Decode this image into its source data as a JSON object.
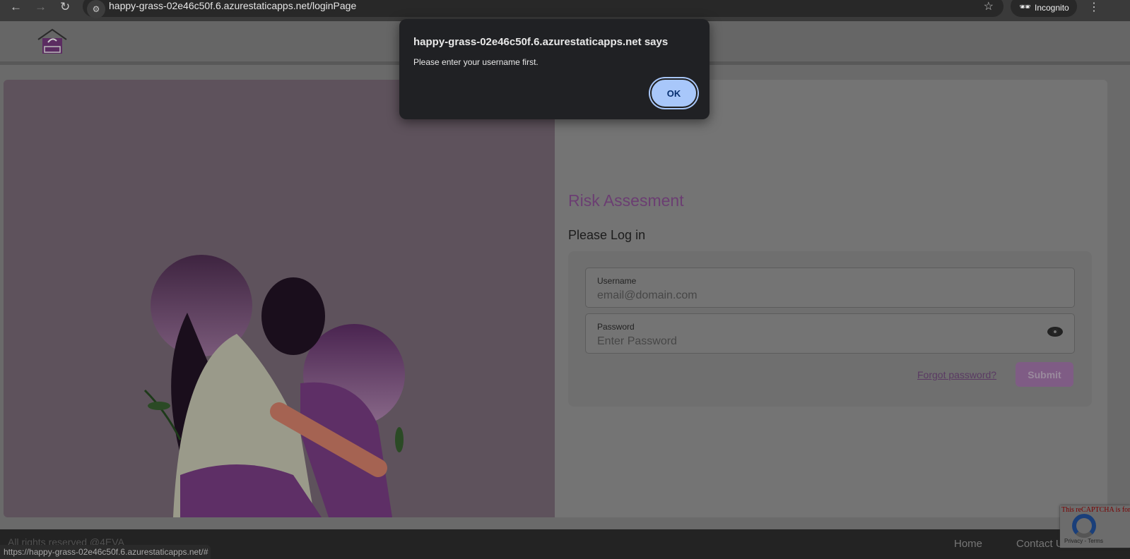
{
  "browser": {
    "url": "happy-grass-02e46c50f.6.azurestaticapps.net/loginPage",
    "profile": "Incognito",
    "status_url": "https://happy-grass-02e46c50f.6.azurestaticapps.net/#"
  },
  "login": {
    "title": "Risk Assesment",
    "subtitle": "Please Log in",
    "username_label": "Username",
    "username_placeholder": "email@domain.com",
    "password_label": "Password",
    "password_placeholder": "Enter Password",
    "forgot": "Forgot password?",
    "submit": "Submit"
  },
  "footer": {
    "copyright": "All rights reserved @4EVA",
    "links": [
      "Home",
      "Contact Us"
    ]
  },
  "captcha": {
    "warning": "This reCAPTCHA is for testing purposes only. Please report to the site admin if you are seeing this.",
    "terms": "Privacy - Terms"
  },
  "dialog": {
    "title": "happy-grass-02e46c50f.6.azurestaticapps.net says",
    "message": "Please enter your username first.",
    "ok": "OK"
  }
}
